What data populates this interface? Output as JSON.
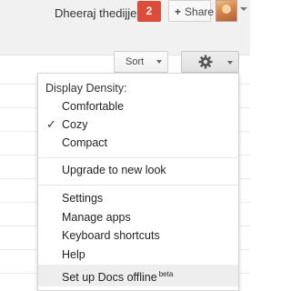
{
  "header": {
    "username": "Dheeraj thedijje",
    "notification_count": "2",
    "share_label": "Share"
  },
  "toolbar": {
    "sort_label": "Sort"
  },
  "menu": {
    "density_header": "Display Density:",
    "density_options": [
      "Comfortable",
      "Cozy",
      "Compact"
    ],
    "selected_density": "Cozy",
    "upgrade": "Upgrade to new look",
    "settings": "Settings",
    "manage_apps": "Manage apps",
    "keyboard_shortcuts": "Keyboard shortcuts",
    "help": "Help",
    "docs_offline": "Set up Docs offline",
    "beta_badge": "beta"
  },
  "colors": {
    "notification": "#dd4b39",
    "menu_hover": "#eeeeee"
  }
}
